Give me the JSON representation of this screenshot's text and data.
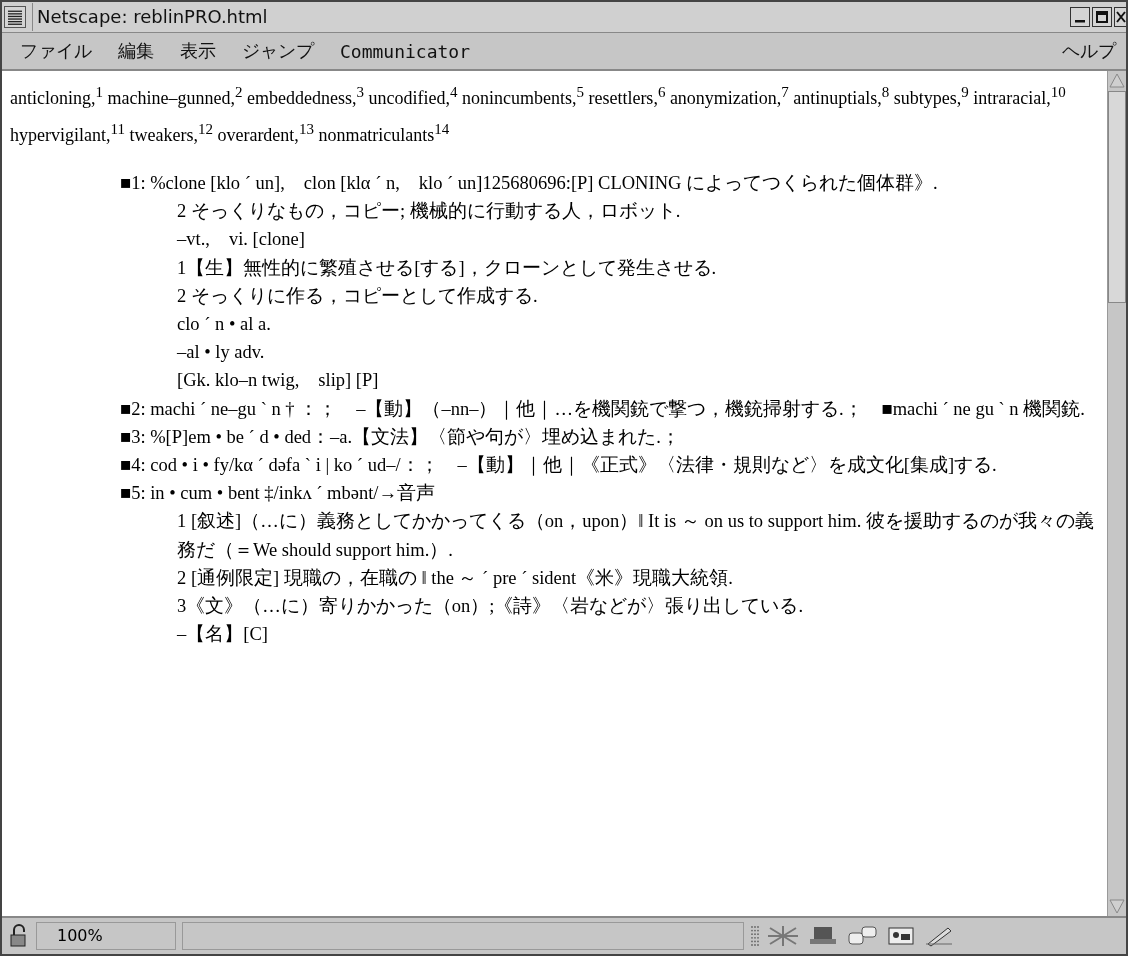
{
  "window": {
    "title": "Netscape: reblinPRO.html"
  },
  "menu": [
    {
      "label": "ファイル"
    },
    {
      "label": "編集"
    },
    {
      "label": "表示"
    },
    {
      "label": "ジャンプ"
    },
    {
      "label": "Communicator"
    }
  ],
  "help_menu": {
    "label": "ヘルプ"
  },
  "content": {
    "word_list": "anticloning,$^{1}$ machine–gunned,$^{2}$ embeddedness,$^{3}$ uncodified,$^{4}$ nonincumbents,$^{5}$ resettlers,$^{6}$ anonymization,$^{7}$ antinuptials,$^{8}$ subtypes,$^{9}$ intraracial,$^{10}$ hypervigilant,$^{11}$ tweakers,$^{12}$ overardent,$^{13}$ nonmatriculants$^{14}$",
    "entries": [
      {
        "text": "■1: %clone [klo ´ un],　clon [klα ´ n,　klo ´ un]125680696:[P] CLONING によってつくられた個体群》.",
        "children": [
          {
            "text": "2 そっくりなもの，コピー; 機械的に行動する人，ロボット."
          },
          {
            "text": "–vt.,　vi. [clone]"
          },
          {
            "text": "1【生】無性的に繁殖させる[する]，クローンとして発生させる."
          },
          {
            "text": "2 そっくりに作る，コピーとして作成する."
          },
          {
            "text": "clo ´ n • al a."
          },
          {
            "text": "–al • ly adv."
          },
          {
            "text": "[Gk. klo–n twig,　slip] [P]"
          }
        ]
      },
      {
        "text": "■2: machi ´ ne–gu ` n † ：；　–【動】（–nn–）｜他｜…を機関銃で撃つ，機銃掃射する.；　■machi ´ ne gu ` n 機関銃."
      },
      {
        "text": "■3: %[P]em • be ´ d • ded：–a.【文法】〈節や句が〉埋め込まれた.；"
      },
      {
        "text": "■4: cod • i • fy/kα ´ dəfa ` i | ko ´ ud–/：；　–【動】｜他｜《正式》〈法律・規則など〉を成文化[集成]する."
      },
      {
        "text": "■5: in • cum • bent ‡/inkʌ ´ mbənt/→音声",
        "children": [
          {
            "text": "1 [叙述]（…に）義務としてかかってくる（on，upon）‖ It is ～ on us to support him. 彼を援助するのが我々の義務だ（＝We should support him.）."
          },
          {
            "text": "2 [通例限定] 現職の，在職の ‖ the ～ ´ pre ´ sident《米》現職大統領."
          },
          {
            "text": "3《文》（…に）寄りかかった（on）;《詩》〈岩などが〉張り出している."
          },
          {
            "text": "–【名】[C]"
          }
        ]
      }
    ]
  },
  "status_bar": {
    "zoom": "100%"
  }
}
